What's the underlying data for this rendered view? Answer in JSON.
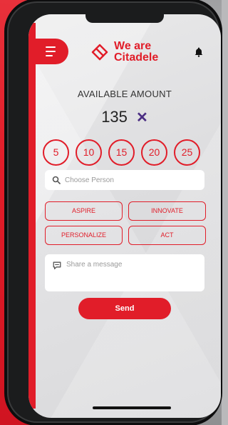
{
  "app": {
    "brand_line1": "We are",
    "brand_line2": "Citadele",
    "accent": "#e11d29"
  },
  "icons": {
    "menu": "menu-icon",
    "bell": "bell-icon",
    "search": "search-icon",
    "message": "message-icon",
    "close": "close-icon"
  },
  "available": {
    "label": "AVAILABLE AMOUNT",
    "value": "135",
    "clear_symbol": "✕"
  },
  "amount_options": [
    "5",
    "10",
    "15",
    "20",
    "25"
  ],
  "search": {
    "placeholder": "Choose Person"
  },
  "values": [
    "ASPIRE",
    "INNOVATE",
    "PERSONALIZE",
    "ACT"
  ],
  "message": {
    "placeholder": "Share a message"
  },
  "send_label": "Send"
}
